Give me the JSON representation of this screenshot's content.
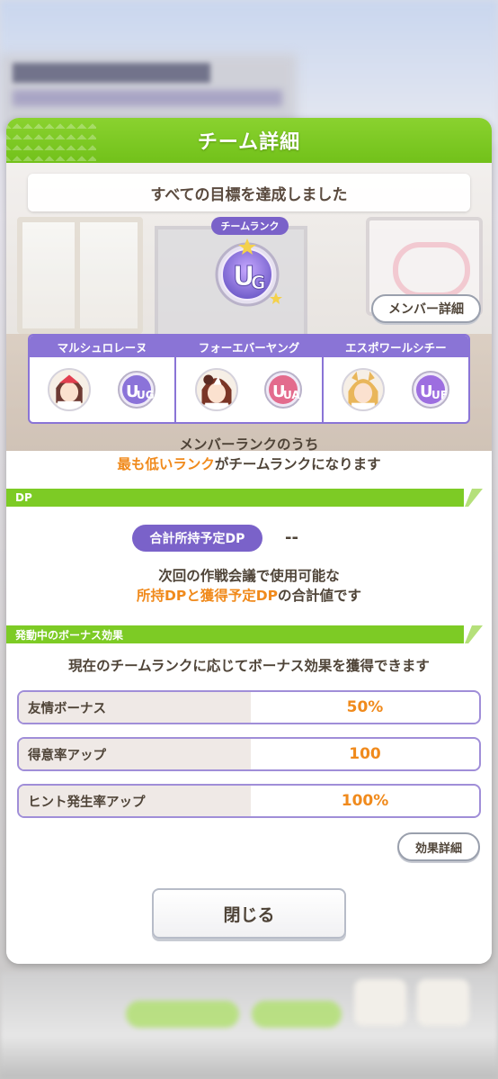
{
  "dialog": {
    "title": "チーム詳細",
    "goal_banner": "すべての目標を達成しました",
    "team_rank_label": "チームランク",
    "team_rank": "UG",
    "member_detail_button": "メンバー詳細",
    "members": [
      {
        "name": "マルシュロレーヌ",
        "rank": "UG"
      },
      {
        "name": "フォーエバーヤング",
        "rank": "UA"
      },
      {
        "name": "エスポワールシチー",
        "rank": "UF"
      }
    ],
    "rank_note_line1": "メンバーランクのうち",
    "rank_note_line2_orange": "最も低いランク",
    "rank_note_line2_rest": "がチームランクになります",
    "dp_section": {
      "title": "DP",
      "chip_label": "合計所持予定DP",
      "value": "--",
      "note_line1": "次回の作戦会議で使用可能な",
      "note_line2_orange": "所持DPと獲得予定DP",
      "note_line2_rest": "の合計値です"
    },
    "bonus_section": {
      "title": "発動中のボーナス効果",
      "description": "現在のチームランクに応じてボーナス効果を獲得できます",
      "rows": [
        {
          "name": "友情ボーナス",
          "value": "50%"
        },
        {
          "name": "得意率アップ",
          "value": "100"
        },
        {
          "name": "ヒント発生率アップ",
          "value": "100%"
        }
      ],
      "detail_button": "効果詳細"
    },
    "close_button": "閉じる"
  },
  "colors": {
    "header_green": "#7dcb25",
    "accent_purple": "#7a62c9",
    "highlight_orange": "#f08a1c",
    "text_brown": "#4f4438"
  }
}
